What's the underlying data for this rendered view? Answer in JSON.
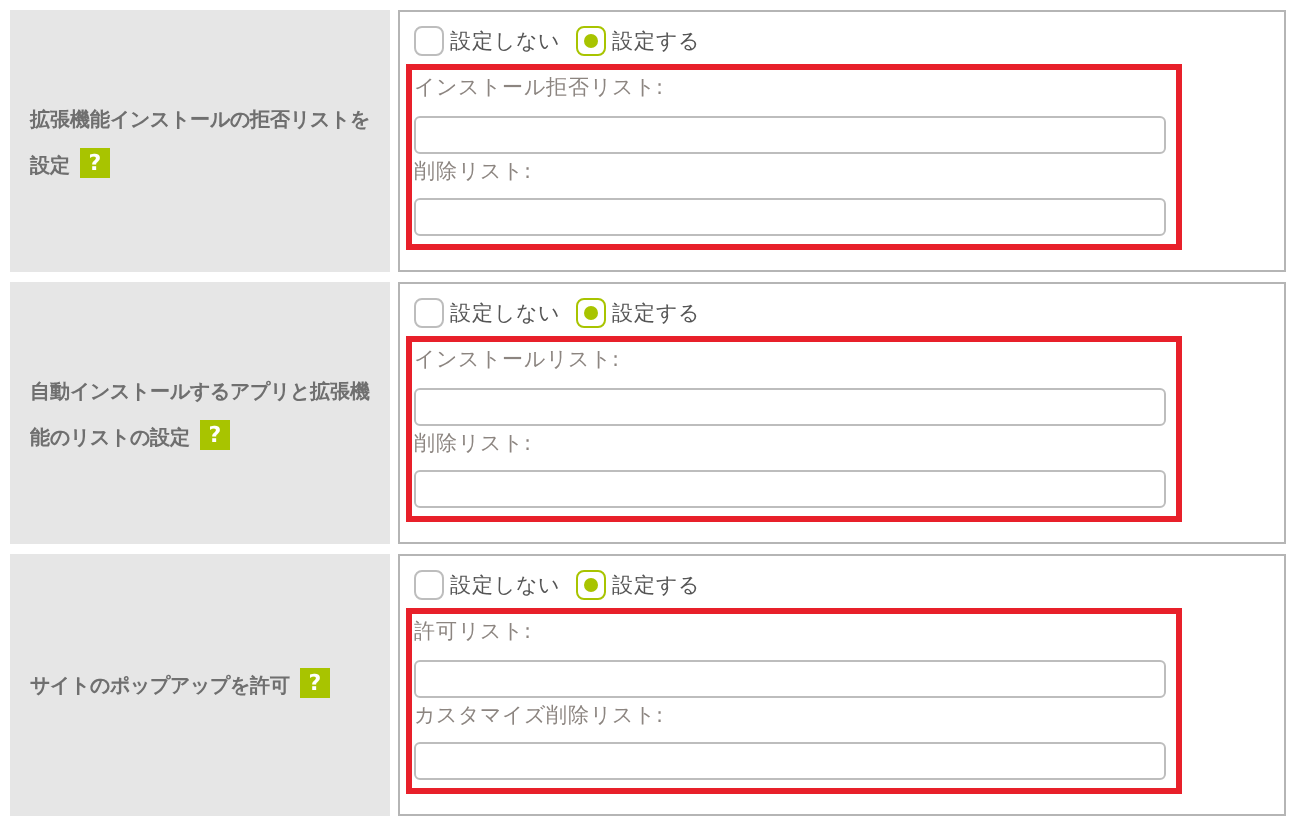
{
  "settings": [
    {
      "label": "拡張機能インストールの拒否リストを設定",
      "help": "?",
      "options": [
        {
          "label": "設定しない",
          "selected": false
        },
        {
          "label": "設定する",
          "selected": true
        }
      ],
      "fields": [
        {
          "label": "インストール拒否リスト:"
        },
        {
          "label": "削除リスト:"
        }
      ]
    },
    {
      "label": "自動インストールするアプリと拡張機能のリストの設定",
      "help": "?",
      "options": [
        {
          "label": "設定しない",
          "selected": false
        },
        {
          "label": "設定する",
          "selected": true
        }
      ],
      "fields": [
        {
          "label": "インストールリスト:"
        },
        {
          "label": "削除リスト:"
        }
      ]
    },
    {
      "label": "サイトのポップアップを許可",
      "help": "?",
      "options": [
        {
          "label": "設定しない",
          "selected": false
        },
        {
          "label": "設定する",
          "selected": true
        }
      ],
      "fields": [
        {
          "label": "許可リスト:"
        },
        {
          "label": "カスタマイズ削除リスト:"
        }
      ]
    }
  ]
}
